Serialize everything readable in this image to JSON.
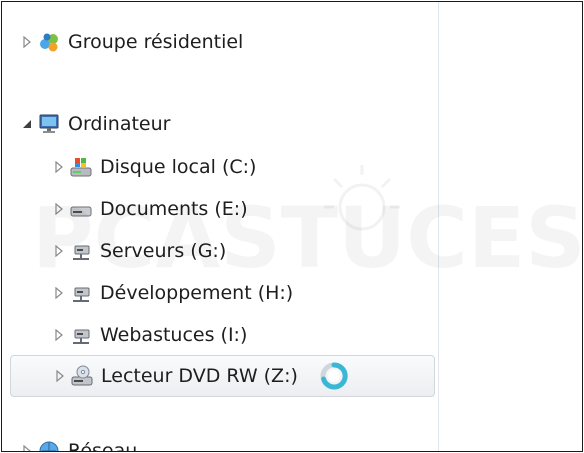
{
  "tree": {
    "homegroup": {
      "label": "Groupe résidentiel",
      "icon": "homegroup-icon",
      "expanded": false
    },
    "computer": {
      "label": "Ordinateur",
      "icon": "computer-icon",
      "expanded": true
    },
    "drives": [
      {
        "label": "Disque local (C:)",
        "icon": "system-drive-icon"
      },
      {
        "label": "Documents (E:)",
        "icon": "hard-drive-icon"
      },
      {
        "label": "Serveurs (G:)",
        "icon": "network-drive-icon"
      },
      {
        "label": "Développement (H:)",
        "icon": "network-drive-icon"
      },
      {
        "label": "Webastuces (I:)",
        "icon": "network-drive-icon"
      },
      {
        "label": "Lecteur DVD RW (Z:)",
        "icon": "dvd-drive-icon",
        "selected": true,
        "loading": true
      }
    ],
    "network": {
      "label": "Réseau",
      "icon": "network-icon"
    }
  },
  "watermark": {
    "text": "PCASTUCES"
  },
  "colors": {
    "text": "#1e1e1e",
    "arrow": "#7a7a7a",
    "selection_border": "#d3d6da",
    "busy_cursor": "#3bb7d6"
  }
}
